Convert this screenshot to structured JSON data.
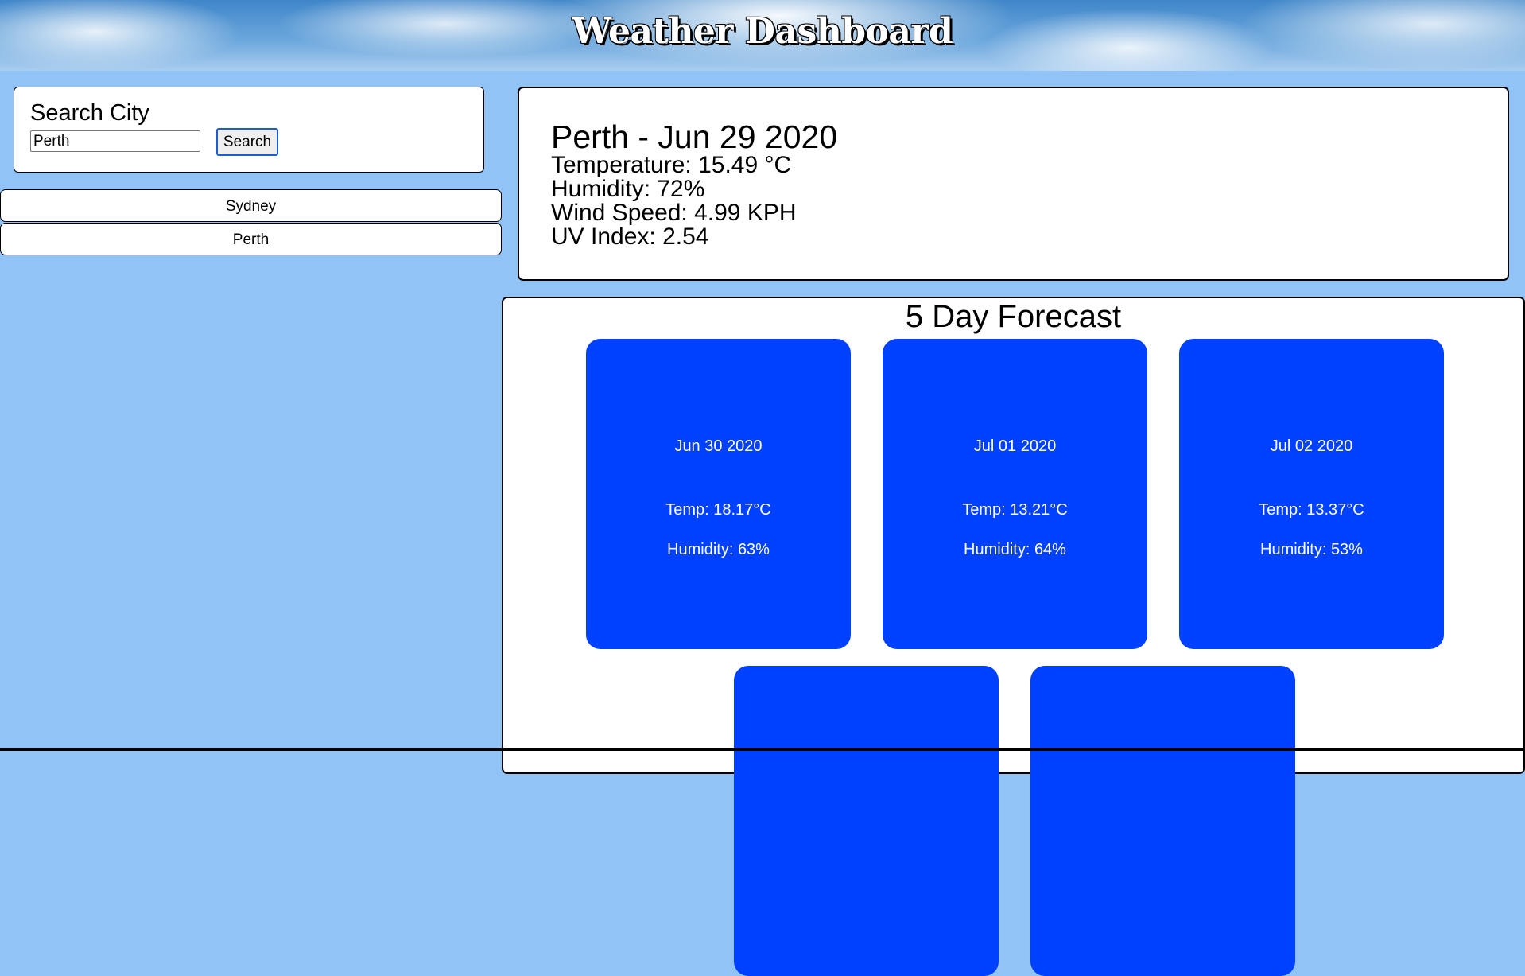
{
  "header": {
    "title": "Weather Dashboard"
  },
  "search": {
    "title": "Search City",
    "input_value": "Perth",
    "button_label": "Search"
  },
  "history": {
    "items": [
      {
        "label": "Sydney"
      },
      {
        "label": "Perth"
      }
    ]
  },
  "current": {
    "heading": "Perth - Jun 29 2020",
    "temperature": "Temperature: 15.49 °C",
    "humidity": "Humidity: 72%",
    "wind": "Wind Speed: 4.99 KPH",
    "uv": "UV Index: 2.54"
  },
  "forecast": {
    "title": "5 Day Forecast",
    "days": [
      {
        "date": "Jun 30 2020",
        "temp": "Temp: 18.17°C",
        "humidity": "Humidity: 63%"
      },
      {
        "date": "Jul 01 2020",
        "temp": "Temp: 13.21°C",
        "humidity": "Humidity: 64%"
      },
      {
        "date": "Jul 02 2020",
        "temp": "Temp: 13.37°C",
        "humidity": "Humidity: 53%"
      },
      {
        "date": "",
        "temp": "",
        "humidity": ""
      },
      {
        "date": "",
        "temp": "",
        "humidity": ""
      }
    ]
  },
  "colors": {
    "page_background": "#92c3f6",
    "card_background": "#0040ff",
    "card_text": "#ffffff"
  }
}
